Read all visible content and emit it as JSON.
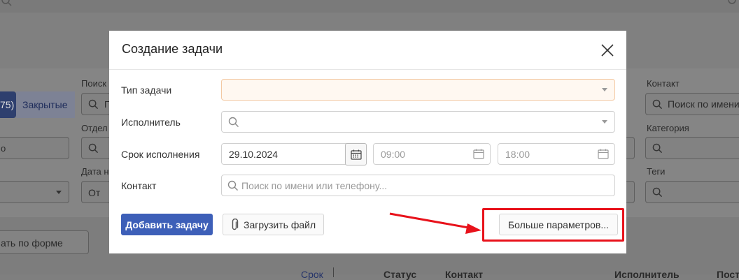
{
  "background": {
    "tabs": {
      "count_fragment": "75)",
      "closed": "Закрытые"
    },
    "labels": {
      "search": "Поиск",
      "department": "Отдел",
      "date": "Дата н",
      "contact": "Контакт",
      "category": "Категория",
      "tags": "Теги"
    },
    "fields": {
      "search_fragment": "П",
      "contact_search": "Поиск по имени",
      "date_from": "От",
      "left_fragment": "о"
    },
    "buttons": {
      "by_form": "ать по форме"
    },
    "table_headers": {
      "deadline": "Срок",
      "status": "Статус",
      "contact": "Контакт",
      "assignee": "Исполнитель",
      "last": "Пост"
    }
  },
  "modal": {
    "title": "Создание задачи",
    "labels": {
      "task_type": "Тип задачи",
      "assignee": "Исполнитель",
      "deadline": "Срок исполнения",
      "contact": "Контакт"
    },
    "fields": {
      "task_type_value": "",
      "assignee_value": "",
      "deadline_date": "29.10.2024",
      "time_from_placeholder": "09:00",
      "time_to_placeholder": "18:00",
      "contact_placeholder": "Поиск по имени или телефону..."
    },
    "buttons": {
      "add_task": "Добавить задачу",
      "upload_file": "Загрузить файл",
      "more_params": "Больше параметров..."
    }
  },
  "annotation": {
    "color": "#e8121b"
  }
}
